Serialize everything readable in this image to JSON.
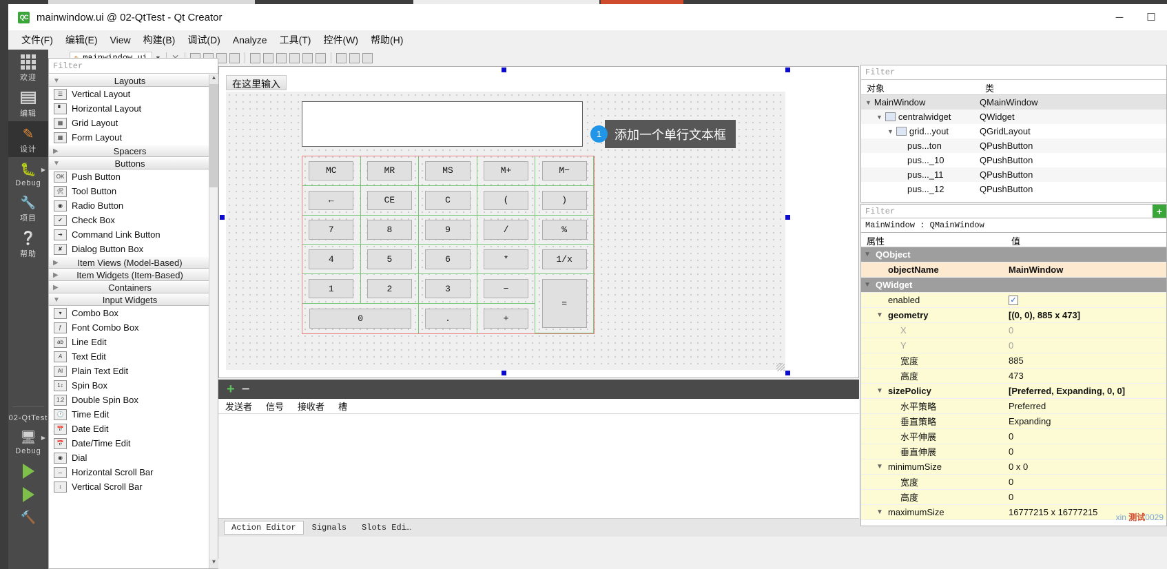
{
  "window": {
    "logo_text": "QC",
    "title": "mainwindow.ui @ 02-QtTest - Qt Creator",
    "minimize": "─",
    "maximize": "☐"
  },
  "menubar": {
    "items": [
      {
        "label": "文件(F)"
      },
      {
        "label": "编辑(E)"
      },
      {
        "label": "View"
      },
      {
        "label": "构建(B)"
      },
      {
        "label": "调试(D)"
      },
      {
        "label": "Analyze"
      },
      {
        "label": "工具(T)"
      },
      {
        "label": "控件(W)"
      },
      {
        "label": "帮助(H)"
      }
    ]
  },
  "activitybar": {
    "items": [
      {
        "label": "欢迎",
        "icon": "grid-icon",
        "active": false,
        "arrow": false
      },
      {
        "label": "编辑",
        "icon": "document-icon",
        "active": false,
        "arrow": false
      },
      {
        "label": "设计",
        "icon": "pencil-icon",
        "active": true,
        "arrow": false
      },
      {
        "label": "Debug",
        "icon": "bug-icon",
        "active": false,
        "arrow": true
      },
      {
        "label": "项目",
        "icon": "wrench-icon",
        "active": false,
        "arrow": false
      },
      {
        "label": "帮助",
        "icon": "help-icon",
        "active": false,
        "arrow": false
      }
    ],
    "project_name": "02-QtTest",
    "kit_label": "Debug",
    "kit_icon": "monitor-icon",
    "run_icon": "run-triangle-icon",
    "debug_icon": "debug-run-icon",
    "build_icon": "hammer-icon"
  },
  "widgetbox": {
    "filter_placeholder": "Filter",
    "groups": [
      {
        "name": "Layouts",
        "expanded": true,
        "items": [
          {
            "label": "Vertical Layout",
            "icon": "vertical-layout-icon"
          },
          {
            "label": "Horizontal Layout",
            "icon": "horizontal-layout-icon"
          },
          {
            "label": "Grid Layout",
            "icon": "grid-layout-icon"
          },
          {
            "label": "Form Layout",
            "icon": "form-layout-icon"
          }
        ]
      },
      {
        "name": "Spacers",
        "expanded": false,
        "items": []
      },
      {
        "name": "Buttons",
        "expanded": true,
        "items": [
          {
            "label": "Push Button",
            "icon": "push-button-icon"
          },
          {
            "label": "Tool Button",
            "icon": "tool-button-icon"
          },
          {
            "label": "Radio Button",
            "icon": "radio-button-icon"
          },
          {
            "label": "Check Box",
            "icon": "check-box-icon"
          },
          {
            "label": "Command Link Button",
            "icon": "command-link-icon"
          },
          {
            "label": "Dialog Button Box",
            "icon": "dialog-button-box-icon"
          }
        ]
      },
      {
        "name": "Item Views (Model-Based)",
        "expanded": false,
        "items": []
      },
      {
        "name": "Item Widgets (Item-Based)",
        "expanded": false,
        "items": []
      },
      {
        "name": "Containers",
        "expanded": false,
        "items": []
      },
      {
        "name": "Input Widgets",
        "expanded": true,
        "items": [
          {
            "label": "Combo Box",
            "icon": "combo-box-icon"
          },
          {
            "label": "Font Combo Box",
            "icon": "font-combo-box-icon"
          },
          {
            "label": "Line Edit",
            "icon": "line-edit-icon"
          },
          {
            "label": "Text Edit",
            "icon": "text-edit-icon"
          },
          {
            "label": "Plain Text Edit",
            "icon": "plain-text-edit-icon"
          },
          {
            "label": "Spin Box",
            "icon": "spin-box-icon"
          },
          {
            "label": "Double Spin Box",
            "icon": "double-spin-box-icon"
          },
          {
            "label": "Time Edit",
            "icon": "time-edit-icon"
          },
          {
            "label": "Date Edit",
            "icon": "date-edit-icon"
          },
          {
            "label": "Date/Time Edit",
            "icon": "date-time-edit-icon"
          },
          {
            "label": "Dial",
            "icon": "dial-icon"
          },
          {
            "label": "Horizontal Scroll Bar",
            "icon": "h-scrollbar-icon"
          },
          {
            "label": "Vertical Scroll Bar",
            "icon": "v-scrollbar-icon"
          }
        ]
      }
    ]
  },
  "editor_toolbar": {
    "lock_icon": "lock-icon",
    "file_icon": "ui-file-icon",
    "filename": "mainwindow.ui",
    "dropdown_icon": "chevron-down-icon",
    "close_icon": "close-icon",
    "tools": [
      "edit-widgets-icon",
      "edit-signals-icon",
      "edit-buddies-icon",
      "edit-tab-order-icon",
      "layout-horizontal-icon",
      "layout-vertical-icon",
      "layout-splitter-h-icon",
      "layout-splitter-v-icon",
      "layout-grid-icon",
      "layout-form-icon",
      "break-layout-icon",
      "adjust-size-icon",
      "preview-icon"
    ]
  },
  "canvas": {
    "menu_placeholder": "在这里输入",
    "lineedit_value": "",
    "callout": {
      "number": "1",
      "text": "添加一个单行文本框"
    },
    "keypad": {
      "rows": [
        [
          {
            "label": "MC"
          },
          {
            "label": "MR"
          },
          {
            "label": "MS"
          },
          {
            "label": "M+"
          },
          {
            "label": "M−"
          }
        ],
        [
          {
            "label": "←"
          },
          {
            "label": "CE"
          },
          {
            "label": "C"
          },
          {
            "label": "("
          },
          {
            "label": ")"
          }
        ],
        [
          {
            "label": "7"
          },
          {
            "label": "8"
          },
          {
            "label": "9"
          },
          {
            "label": "/"
          },
          {
            "label": "%"
          }
        ],
        [
          {
            "label": "4"
          },
          {
            "label": "5"
          },
          {
            "label": "6"
          },
          {
            "label": "*"
          },
          {
            "label": "1/x"
          }
        ],
        [
          {
            "label": "1"
          },
          {
            "label": "2"
          },
          {
            "label": "3"
          },
          {
            "label": "−"
          },
          {
            "label": "=",
            "rowspan": 2
          }
        ],
        [
          {
            "label": "0",
            "colspan": 2
          },
          {
            "label": "."
          },
          {
            "label": "+"
          }
        ]
      ]
    }
  },
  "signal_slot": {
    "add_icon": "plus-icon",
    "remove_icon": "minus-icon",
    "columns": [
      "发送者",
      "信号",
      "接收者",
      "槽"
    ]
  },
  "bottom_tabs": {
    "items": [
      {
        "label": "Action Editor",
        "active": true
      },
      {
        "label": "Signals",
        "active": false
      },
      {
        "label": "Slots Edi…",
        "active": false
      }
    ]
  },
  "object_inspector": {
    "filter_placeholder": "Filter",
    "columns": [
      "对象",
      "类"
    ],
    "rows": [
      {
        "name": "MainWindow",
        "class": "QMainWindow",
        "depth": 0,
        "expanded": true,
        "selected": true,
        "icon": ""
      },
      {
        "name": "centralwidget",
        "class": "QWidget",
        "depth": 1,
        "expanded": true,
        "selected": false,
        "icon": "widget-icon"
      },
      {
        "name": "grid...yout",
        "class": "QGridLayout",
        "depth": 2,
        "expanded": true,
        "selected": false,
        "icon": "grid-layout-icon"
      },
      {
        "name": "pus...ton",
        "class": "QPushButton",
        "depth": 3,
        "expanded": false,
        "selected": false,
        "icon": ""
      },
      {
        "name": "pus..._10",
        "class": "QPushButton",
        "depth": 3,
        "expanded": false,
        "selected": false,
        "icon": ""
      },
      {
        "name": "pus..._11",
        "class": "QPushButton",
        "depth": 3,
        "expanded": false,
        "selected": false,
        "icon": ""
      },
      {
        "name": "pus..._12",
        "class": "QPushButton",
        "depth": 3,
        "expanded": false,
        "selected": false,
        "icon": ""
      }
    ]
  },
  "property_editor": {
    "filter_placeholder": "Filter",
    "add_button_icon": "plus-icon",
    "object_line": "MainWindow : QMainWindow",
    "columns": [
      "属性",
      "值"
    ],
    "rows": [
      {
        "key": "QObject",
        "value": "",
        "type": "group",
        "depth": 0,
        "expanded": true
      },
      {
        "key": "objectName",
        "value": "MainWindow",
        "type": "highlight",
        "depth": 1
      },
      {
        "key": "QWidget",
        "value": "",
        "type": "group",
        "depth": 0,
        "expanded": true
      },
      {
        "key": "enabled",
        "value": "",
        "type": "checkbox",
        "checked": true,
        "depth": 1
      },
      {
        "key": "geometry",
        "value": "[(0, 0), 885 x 473]",
        "type": "bold",
        "depth": 1,
        "expanded": true
      },
      {
        "key": "X",
        "value": "0",
        "type": "dim",
        "depth": 2
      },
      {
        "key": "Y",
        "value": "0",
        "type": "dim",
        "depth": 2
      },
      {
        "key": "宽度",
        "value": "885",
        "type": "normal",
        "depth": 2
      },
      {
        "key": "高度",
        "value": "473",
        "type": "normal",
        "depth": 2
      },
      {
        "key": "sizePolicy",
        "value": "[Preferred, Expanding, 0, 0]",
        "type": "bold",
        "depth": 1,
        "expanded": true
      },
      {
        "key": "水平策略",
        "value": "Preferred",
        "type": "normal",
        "depth": 2
      },
      {
        "key": "垂直策略",
        "value": "Expanding",
        "type": "normal",
        "depth": 2
      },
      {
        "key": "水平伸展",
        "value": "0",
        "type": "normal",
        "depth": 2
      },
      {
        "key": "垂直伸展",
        "value": "0",
        "type": "normal",
        "depth": 2
      },
      {
        "key": "minimumSize",
        "value": "0 x 0",
        "type": "normal",
        "depth": 1,
        "expanded": true
      },
      {
        "key": "宽度",
        "value": "0",
        "type": "normal",
        "depth": 2
      },
      {
        "key": "高度",
        "value": "0",
        "type": "normal",
        "depth": 2
      },
      {
        "key": "maximumSize",
        "value": "16777215 x 16777215",
        "type": "normal",
        "depth": 1,
        "expanded": true
      }
    ]
  },
  "watermark": {
    "prefix": "xin ",
    "bold": "测试",
    "suffix": "0029"
  },
  "colors": {
    "accent": "#2196e8",
    "callout_bg": "#575757",
    "layout_red": "#e88080",
    "layout_green": "#79c779",
    "selection_handle": "#0b0bd0",
    "property_highlight": "#fde8d0",
    "property_yellow": "#fdfbd4"
  }
}
